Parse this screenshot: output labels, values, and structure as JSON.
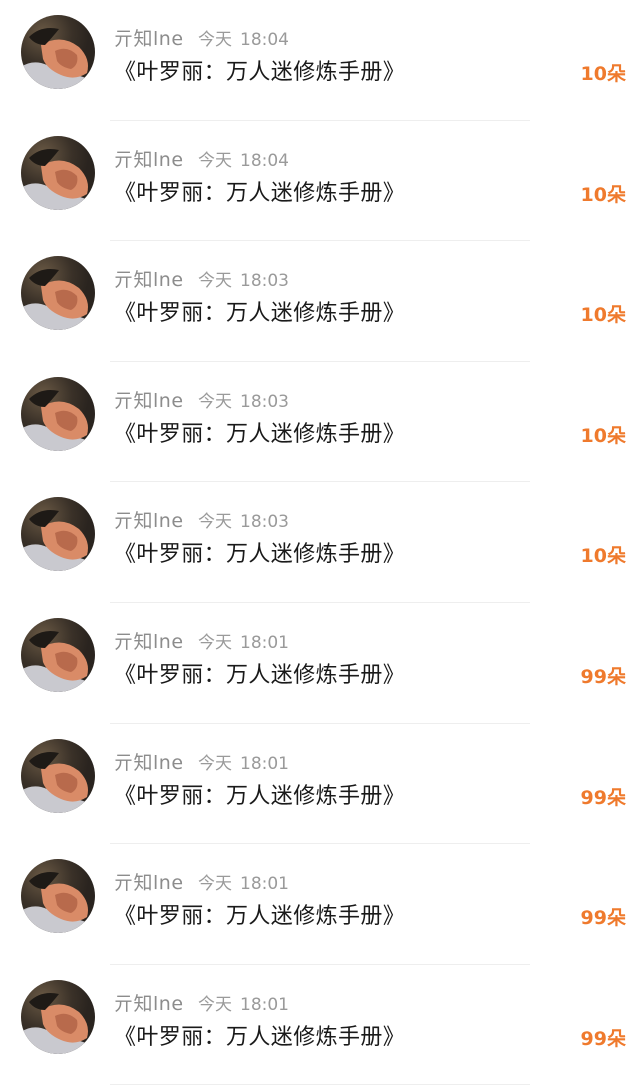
{
  "accent_color": "#ef7a2d",
  "items": [
    {
      "user": "亓知lne",
      "day": "今天",
      "time": "18:04",
      "title": "《叶罗丽：万人迷修炼手册》",
      "count": "10朵"
    },
    {
      "user": "亓知lne",
      "day": "今天",
      "time": "18:04",
      "title": "《叶罗丽：万人迷修炼手册》",
      "count": "10朵"
    },
    {
      "user": "亓知lne",
      "day": "今天",
      "time": "18:03",
      "title": "《叶罗丽：万人迷修炼手册》",
      "count": "10朵"
    },
    {
      "user": "亓知lne",
      "day": "今天",
      "time": "18:03",
      "title": "《叶罗丽：万人迷修炼手册》",
      "count": "10朵"
    },
    {
      "user": "亓知lne",
      "day": "今天",
      "time": "18:03",
      "title": "《叶罗丽：万人迷修炼手册》",
      "count": "10朵"
    },
    {
      "user": "亓知lne",
      "day": "今天",
      "time": "18:01",
      "title": "《叶罗丽：万人迷修炼手册》",
      "count": "99朵"
    },
    {
      "user": "亓知lne",
      "day": "今天",
      "time": "18:01",
      "title": "《叶罗丽：万人迷修炼手册》",
      "count": "99朵"
    },
    {
      "user": "亓知lne",
      "day": "今天",
      "time": "18:01",
      "title": "《叶罗丽：万人迷修炼手册》",
      "count": "99朵"
    },
    {
      "user": "亓知lne",
      "day": "今天",
      "time": "18:01",
      "title": "《叶罗丽：万人迷修炼手册》",
      "count": "99朵"
    }
  ]
}
